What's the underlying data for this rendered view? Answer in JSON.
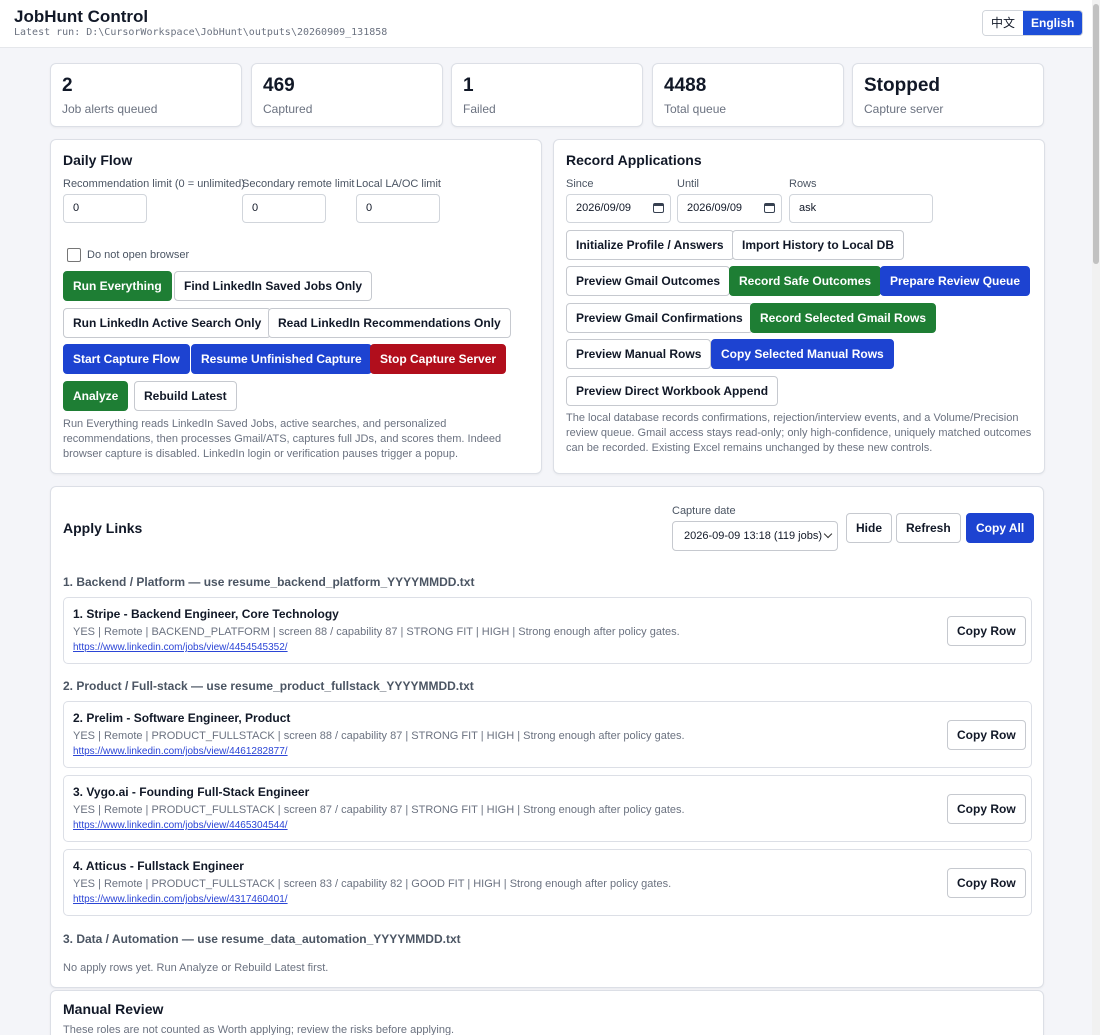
{
  "header": {
    "title": "JobHunt Control",
    "latest_run": "Latest run: D:\\CursorWorkspace\\JobHunt\\outputs\\20260909_131858",
    "lang_zh": "中文",
    "lang_en": "English"
  },
  "stats": [
    {
      "value": "2",
      "label": "Job alerts queued"
    },
    {
      "value": "469",
      "label": "Captured"
    },
    {
      "value": "1",
      "label": "Failed"
    },
    {
      "value": "4488",
      "label": "Total queue"
    },
    {
      "value": "Stopped",
      "label": "Capture server"
    }
  ],
  "daily_flow": {
    "title": "Daily Flow",
    "rec_limit_label": "Recommendation limit (0 = unlimited)",
    "rec_limit_value": "0",
    "secondary_label": "Secondary remote limit",
    "secondary_value": "0",
    "local_label": "Local LA/OC limit",
    "local_value": "0",
    "no_browser_label": "Do not open browser",
    "buttons": {
      "run_everything": "Run Everything",
      "find_saved": "Find LinkedIn Saved Jobs Only",
      "active_search": "Run LinkedIn Active Search Only",
      "read_recs": "Read LinkedIn Recommendations Only",
      "start_capture": "Start Capture Flow",
      "resume_capture": "Resume Unfinished Capture",
      "stop_server": "Stop Capture Server",
      "analyze": "Analyze",
      "rebuild": "Rebuild Latest"
    },
    "help": "Run Everything reads LinkedIn Saved Jobs, active searches, and personalized recommendations, then processes Gmail/ATS, captures full JDs, and scores them. Indeed browser capture is disabled. LinkedIn login or verification pauses trigger a popup."
  },
  "record": {
    "title": "Record Applications",
    "since_label": "Since",
    "since_value": "2026/09/09",
    "until_label": "Until",
    "until_value": "2026/09/09",
    "rows_label": "Rows",
    "rows_value": "ask",
    "buttons": {
      "init_profile": "Initialize Profile / Answers",
      "import_history": "Import History to Local DB",
      "preview_gmail_outcomes": "Preview Gmail Outcomes",
      "record_safe": "Record Safe Outcomes",
      "prepare_review": "Prepare Review Queue",
      "preview_gmail_conf": "Preview Gmail Confirmations",
      "record_selected_gmail": "Record Selected Gmail Rows",
      "preview_manual": "Preview Manual Rows",
      "copy_selected_manual": "Copy Selected Manual Rows",
      "preview_direct": "Preview Direct Workbook Append"
    },
    "help": "The local database records confirmations, rejection/interview events, and a Volume/Precision review queue. Gmail access stays read-only; only high-confidence, uniquely matched outcomes can be recorded. Existing Excel remains unchanged by these new controls."
  },
  "apply_links": {
    "title": "Apply Links",
    "capture_date_label": "Capture date",
    "capture_date_value": "2026-09-09 13:18 (119 jobs)",
    "hide": "Hide",
    "refresh": "Refresh",
    "copy_all": "Copy All",
    "copy_row": "Copy Row",
    "sections": [
      {
        "heading": "1. Backend / Platform — use resume_backend_platform_YYYYMMDD.txt"
      },
      {
        "heading": "2. Product / Full-stack — use resume_product_fullstack_YYYYMMDD.txt"
      },
      {
        "heading": "3. Data / Automation — use resume_data_automation_YYYYMMDD.txt"
      }
    ],
    "jobs": [
      {
        "title": "1. Stripe - Backend Engineer, Core Technology",
        "meta": "YES | Remote | BACKEND_PLATFORM | screen 88 / capability 87 | STRONG FIT | HIGH | Strong enough after policy gates.",
        "link": "https://www.linkedin.com/jobs/view/4454545352/"
      },
      {
        "title": "2. Prelim - Software Engineer, Product",
        "meta": "YES | Remote | PRODUCT_FULLSTACK | screen 88 / capability 87 | STRONG FIT | HIGH | Strong enough after policy gates.",
        "link": "https://www.linkedin.com/jobs/view/4461282877/"
      },
      {
        "title": "3. Vygo.ai - Founding Full-Stack Engineer",
        "meta": "YES | Remote | PRODUCT_FULLSTACK | screen 87 / capability 87 | STRONG FIT | HIGH | Strong enough after policy gates.",
        "link": "https://www.linkedin.com/jobs/view/4465304544/"
      },
      {
        "title": "4. Atticus - Fullstack Engineer",
        "meta": "YES | Remote | PRODUCT_FULLSTACK | screen 83 / capability 82 | GOOD FIT | HIGH | Strong enough after policy gates.",
        "link": "https://www.linkedin.com/jobs/view/4317460401/"
      }
    ],
    "empty_note": "No apply rows yet. Run Analyze or Rebuild Latest first."
  },
  "manual_review": {
    "title": "Manual Review",
    "note": "These roles are not counted as Worth applying; review the risks before applying."
  }
}
